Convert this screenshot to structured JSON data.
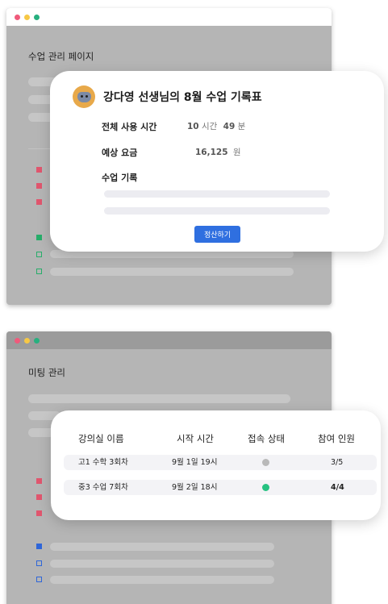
{
  "colors": {
    "dot_red": "#f05a7b",
    "dot_yellow": "#f7c845",
    "dot_green": "#27b07f",
    "square_red": "#e0566e",
    "square_green": "#27ad6a",
    "square_blue": "#2f66d8",
    "button_blue": "#2f6fe0",
    "status_offline": "#b9b9b9",
    "status_online": "#26c281"
  },
  "window1": {
    "title": "수업 관리 페이지"
  },
  "record_card": {
    "avatar_icon": "elephant-avatar-icon",
    "title": "강다영 선생님의 8월 수업 기록표",
    "total_time_label": "전체 사용 시간",
    "total_hours": "10",
    "hours_unit": "시간",
    "total_minutes": "49",
    "minutes_unit": "분",
    "fee_label": "예상 요금",
    "fee_amount": "16,125",
    "fee_unit": "원",
    "record_label": "수업 기록",
    "settle_button": "정산하기"
  },
  "window2": {
    "title": "미팅 관리"
  },
  "meeting_table": {
    "headers": [
      "강의실 이름",
      "시작 시간",
      "접속 상태",
      "참여 인원"
    ],
    "rows": [
      {
        "name": "고1 수학 3회차",
        "start": "9월 1일 19시",
        "status": "offline",
        "participants": "3/5"
      },
      {
        "name": "중3 수업 7회차",
        "start": "9월 2일 18시",
        "status": "online",
        "participants": "4/4"
      }
    ]
  }
}
